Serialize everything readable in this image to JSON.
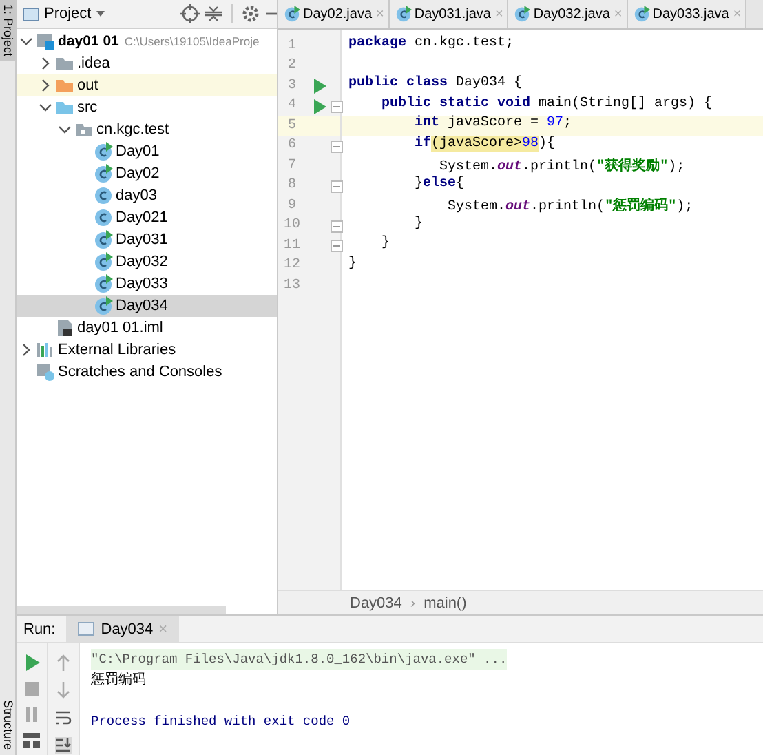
{
  "side_strip": {
    "top_tab": "1: Project",
    "bottom_tab": "Structure"
  },
  "project_panel": {
    "title": "Project",
    "tree": [
      {
        "label": "day01 01",
        "hint": "C:\\Users\\19105\\IdeaProje",
        "kind": "module",
        "expanded": true,
        "selected": false,
        "highlighted": false,
        "children": [
          {
            "label": ".idea",
            "kind": "folder",
            "expanded": false,
            "selected": false,
            "highlighted": false
          },
          {
            "label": "out",
            "kind": "folder-excluded",
            "expanded": false,
            "selected": false,
            "highlighted": true
          },
          {
            "label": "src",
            "kind": "folder-source",
            "expanded": true,
            "selected": false,
            "highlighted": false,
            "children": [
              {
                "label": "cn.kgc.test",
                "kind": "package",
                "expanded": true,
                "selected": false,
                "highlighted": false,
                "children": [
                  {
                    "label": "Day01",
                    "kind": "class-run",
                    "selected": false,
                    "highlighted": false
                  },
                  {
                    "label": "Day02",
                    "kind": "class-run",
                    "selected": false,
                    "highlighted": false
                  },
                  {
                    "label": "day03",
                    "kind": "class",
                    "selected": false,
                    "highlighted": false
                  },
                  {
                    "label": "Day021",
                    "kind": "class",
                    "selected": false,
                    "highlighted": false
                  },
                  {
                    "label": "Day031",
                    "kind": "class-run",
                    "selected": false,
                    "highlighted": false
                  },
                  {
                    "label": "Day032",
                    "kind": "class-run",
                    "selected": false,
                    "highlighted": false
                  },
                  {
                    "label": "Day033",
                    "kind": "class-run",
                    "selected": false,
                    "highlighted": false
                  },
                  {
                    "label": "Day034",
                    "kind": "class-run",
                    "selected": true,
                    "highlighted": false
                  }
                ]
              }
            ]
          },
          {
            "label": "day01 01.iml",
            "kind": "iml",
            "selected": false,
            "highlighted": false
          }
        ]
      },
      {
        "label": "External Libraries",
        "kind": "libraries",
        "expanded": false,
        "selected": false,
        "highlighted": false
      },
      {
        "label": "Scratches and Consoles",
        "kind": "scratches",
        "selected": false,
        "highlighted": false
      }
    ]
  },
  "editor": {
    "tabs": [
      {
        "label": "Day02.java",
        "close": "×",
        "selected": false
      },
      {
        "label": "Day031.java",
        "close": "×",
        "selected": false
      },
      {
        "label": "Day032.java",
        "close": "×",
        "selected": false
      },
      {
        "label": "Day033.java",
        "close": "×",
        "selected": false
      }
    ],
    "lines": [
      {
        "number": "1",
        "run": false,
        "fold": false,
        "current": false,
        "tokens": [
          {
            "t": "package",
            "kind": "keyword"
          },
          {
            "t": " cn.kgc.test;",
            "kind": "plain"
          }
        ]
      },
      {
        "number": "2",
        "run": false,
        "fold": false,
        "current": false
      },
      {
        "number": "3",
        "run": true,
        "fold": false,
        "current": false,
        "tokens": [
          {
            "t": "public class",
            "kind": "keyword"
          },
          {
            "t": " Day034 {",
            "kind": "plain"
          }
        ]
      },
      {
        "number": "4",
        "run": true,
        "fold": true,
        "current": false,
        "tokens": [
          {
            "t": "    public static void",
            "kind": "keyword"
          },
          {
            "t": " main(String[] args) {",
            "kind": "plain"
          }
        ]
      },
      {
        "number": "5",
        "run": false,
        "fold": false,
        "current": true,
        "tokens": [
          {
            "t": "        int",
            "kind": "keyword"
          },
          {
            "t": " javaScore = ",
            "kind": "plain"
          },
          {
            "t": "97",
            "kind": "number"
          },
          {
            "t": ";",
            "kind": "plain"
          }
        ]
      },
      {
        "number": "6",
        "run": false,
        "fold": true,
        "current": false,
        "tokens": [
          {
            "t": "        if",
            "kind": "keyword"
          },
          {
            "t": "(javaScore>",
            "kind": "match"
          },
          {
            "t": "98",
            "kind": "match-number"
          },
          {
            "t": "){",
            "kind": "plain"
          }
        ]
      },
      {
        "number": "7",
        "run": false,
        "fold": false,
        "current": false,
        "tokens": [
          {
            "t": "           System.",
            "kind": "plain"
          },
          {
            "t": "out",
            "kind": "field"
          },
          {
            "t": ".println(",
            "kind": "plain"
          },
          {
            "t": "\"获得奖励\"",
            "kind": "string"
          },
          {
            "t": ");",
            "kind": "plain"
          }
        ]
      },
      {
        "number": "8",
        "run": false,
        "fold": true,
        "current": false,
        "tokens": [
          {
            "t": "        }",
            "kind": "plain"
          },
          {
            "t": "else",
            "kind": "keyword"
          },
          {
            "t": "{",
            "kind": "plain"
          }
        ]
      },
      {
        "number": "9",
        "run": false,
        "fold": false,
        "current": false,
        "tokens": [
          {
            "t": "            System.",
            "kind": "plain"
          },
          {
            "t": "out",
            "kind": "field"
          },
          {
            "t": ".println(",
            "kind": "plain"
          },
          {
            "t": "\"惩罚编码\"",
            "kind": "string"
          },
          {
            "t": ");",
            "kind": "plain"
          }
        ]
      },
      {
        "number": "10",
        "run": false,
        "fold": true,
        "current": false,
        "tokens": [
          {
            "t": "        }",
            "kind": "plain"
          }
        ]
      },
      {
        "number": "11",
        "run": false,
        "fold": true,
        "current": false,
        "tokens": [
          {
            "t": "    }",
            "kind": "plain"
          }
        ]
      },
      {
        "number": "12",
        "run": false,
        "fold": false,
        "current": false,
        "tokens": [
          {
            "t": "}",
            "kind": "plain"
          }
        ]
      },
      {
        "number": "13",
        "run": false,
        "fold": false,
        "current": false
      }
    ],
    "breadcrumb": [
      "Day034",
      "main()"
    ],
    "breadcrumb_separator": "›"
  },
  "run_panel": {
    "label": "Run:",
    "tab": {
      "label": "Day034",
      "close": "×",
      "selected": true
    },
    "console": [
      {
        "kind": "command",
        "text": "\"C:\\Program Files\\Java\\jdk1.8.0_162\\bin\\java.exe\" ..."
      },
      {
        "kind": "output",
        "text": "惩罚编码"
      },
      {
        "kind": "blank"
      },
      {
        "kind": "system",
        "text": "Process finished with exit code 0"
      }
    ]
  }
}
